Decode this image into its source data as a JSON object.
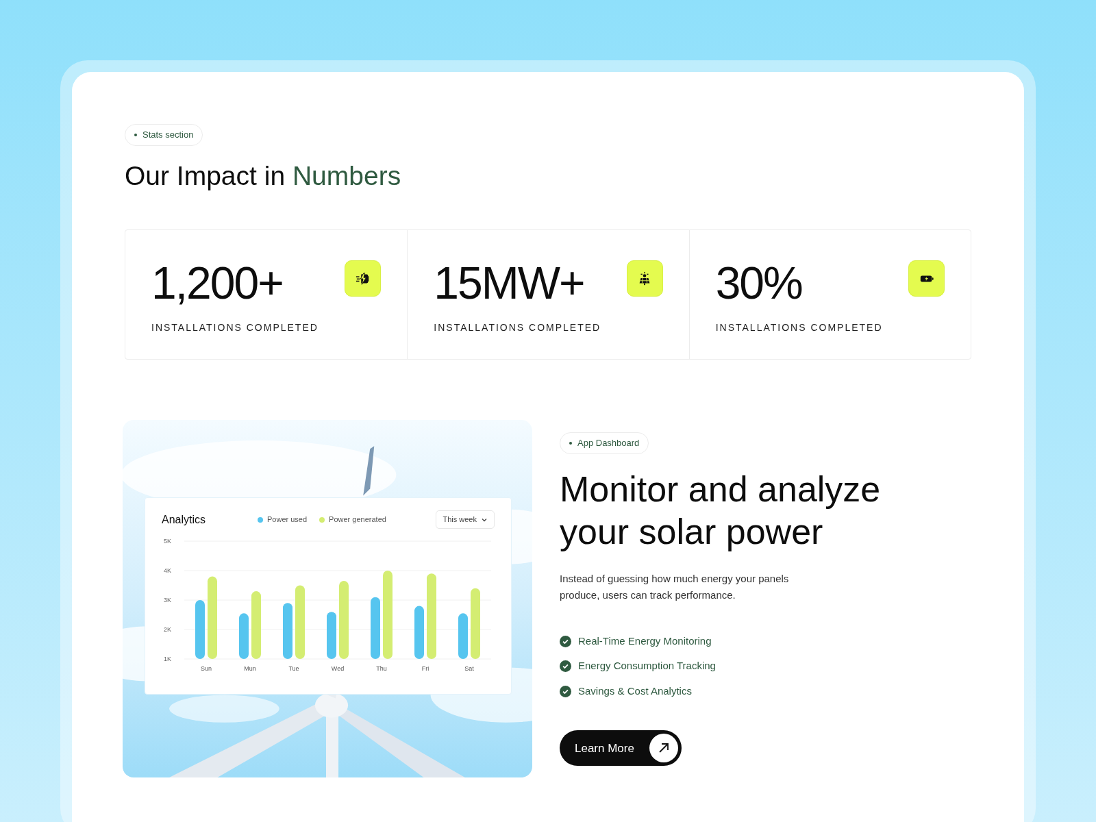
{
  "stats_section": {
    "badge": "Stats section",
    "title": "Our Impact in **Numbers**",
    "stats": [
      {
        "value": "1,200+",
        "label": "INSTALLATIONS COMPLETED"
      },
      {
        "value": "15MW+",
        "label": "INSTALLATIONS COMPLETED"
      },
      {
        "value": "30%",
        "label": "INSTALLATIONS COMPLETED"
      }
    ]
  },
  "analytics": {
    "title": "Analytics",
    "period": "This week",
    "chart_data": {
      "type": "bar",
      "grid": true,
      "categories": [
        "Sun",
        "Mun",
        "Tue",
        "Wed",
        "Thu",
        "Fri",
        "Sat"
      ],
      "ylim": [
        1000,
        5000
      ],
      "yticks": [
        {
          "value": 5000,
          "label": "5K"
        },
        {
          "value": 4000,
          "label": "4K"
        },
        {
          "value": 3000,
          "label": "3K"
        },
        {
          "value": 2000,
          "label": "2K"
        },
        {
          "value": 1000,
          "label": "1K"
        }
      ],
      "series": [
        {
          "name": "Power used",
          "color": "#56c5ef",
          "values": [
            3000,
            2550,
            2900,
            2600,
            3100,
            2800,
            2550
          ]
        },
        {
          "name": "Power generated",
          "color": "#d4ed72",
          "values": [
            3800,
            3300,
            3500,
            3650,
            4000,
            3900,
            3400
          ]
        }
      ]
    }
  },
  "dashboard_section": {
    "badge": "App Dashboard",
    "title": "Monitor and analyze your solar power",
    "description": "Instead of guessing how much energy your panels produce, users can track performance.",
    "features": [
      "Real-Time Energy Monitoring",
      "Energy Consumption Tracking",
      "Savings & Cost Analytics"
    ],
    "button": "Learn More"
  }
}
